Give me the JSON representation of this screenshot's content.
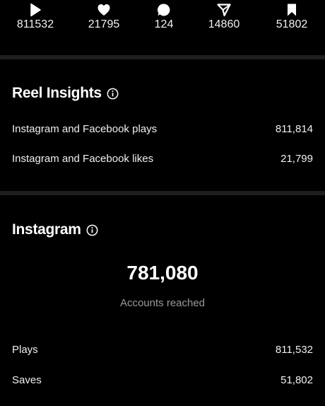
{
  "stats": [
    {
      "icon": "play-icon",
      "value": "811532"
    },
    {
      "icon": "heart-icon",
      "value": "21795"
    },
    {
      "icon": "comment-icon",
      "value": "124"
    },
    {
      "icon": "share-icon",
      "value": "14860"
    },
    {
      "icon": "bookmark-icon",
      "value": "51802"
    }
  ],
  "reel_insights": {
    "title": "Reel Insights",
    "rows": [
      {
        "label": "Instagram and Facebook plays",
        "value": "811,814"
      },
      {
        "label": "Instagram and Facebook likes",
        "value": "21,799"
      }
    ]
  },
  "instagram": {
    "title": "Instagram",
    "accounts_reached": "781,080",
    "accounts_reached_label": "Accounts reached",
    "rows": [
      {
        "label": "Plays",
        "value": "811,532"
      },
      {
        "label": "Saves",
        "value": "51,802"
      }
    ]
  }
}
